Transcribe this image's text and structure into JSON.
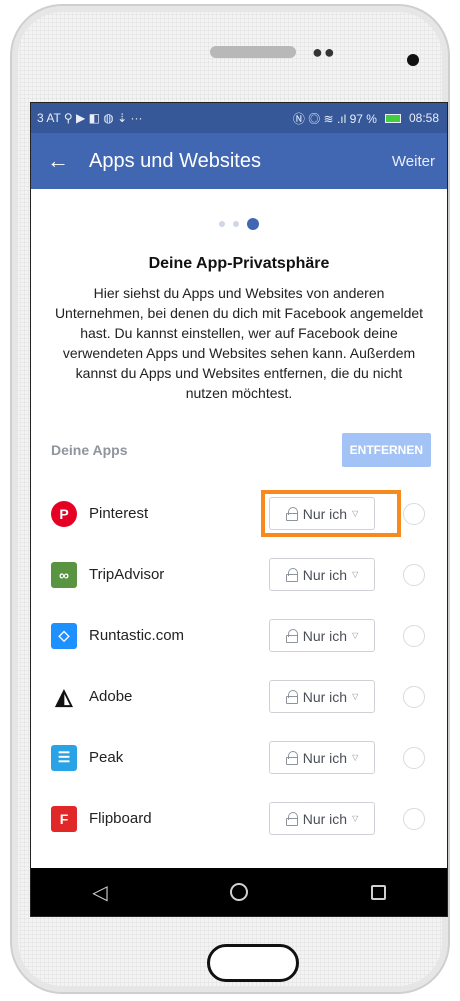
{
  "status_bar": {
    "left_text": "3 AT ⚲ ▶ ◧ ◍ ⇣ ···",
    "right_text": "Ⓝ ◎ ≋ .ıl 97 %",
    "time": "08:58",
    "battery_color": "#3fcf3f"
  },
  "app_bar": {
    "title": "Apps und Websites",
    "next_label": "Weiter",
    "color": "#4267b2"
  },
  "content": {
    "heading": "Deine App-Privatsphäre",
    "description": "Hier siehst du Apps und Websites von anderen Unternehmen, bei denen du dich mit Facebook angemeldet hast. Du kannst einstellen, wer auf Facebook deine verwendeten Apps und Websites sehen kann. Außerdem kannst du Apps und Websites entfernen, die du nicht nutzen möchtest.",
    "apps_title": "Deine Apps",
    "remove_label": "ENTFERNEN"
  },
  "apps": [
    {
      "name": "Pinterest",
      "icon": "pinterest-icon",
      "privacy": "Nur ich",
      "color": "#e60023"
    },
    {
      "name": "TripAdvisor",
      "icon": "tripadvisor-icon",
      "privacy": "Nur ich",
      "color": "#589442"
    },
    {
      "name": "Runtastic.com",
      "icon": "runtastic-icon",
      "privacy": "Nur ich",
      "color": "#1e90ff"
    },
    {
      "name": "Adobe",
      "icon": "adobe-icon",
      "privacy": "Nur ich",
      "color": "#111111"
    },
    {
      "name": "Peak",
      "icon": "peak-icon",
      "privacy": "Nur ich",
      "color": "#29a3e6"
    },
    {
      "name": "Flipboard",
      "icon": "flipboard-icon",
      "privacy": "Nur ich",
      "color": "#e12828"
    }
  ],
  "highlight_color": "#f68a1e"
}
